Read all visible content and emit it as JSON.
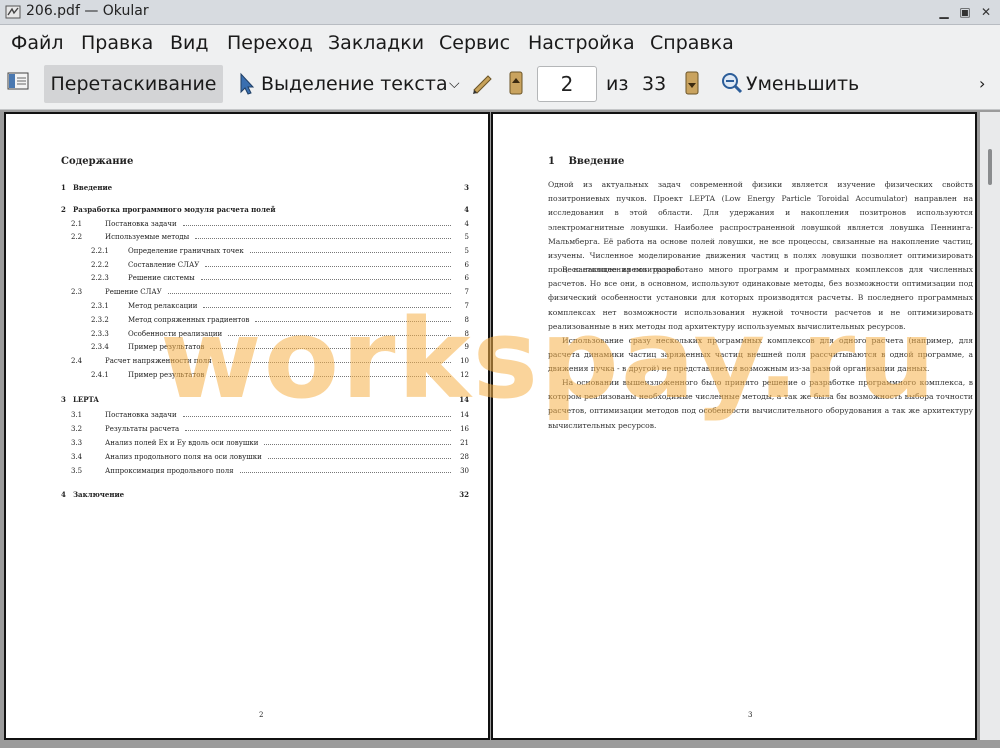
{
  "window": {
    "title": "206.pdf  — Okular"
  },
  "menu": [
    "Файл",
    "Правка",
    "Вид",
    "Переход",
    "Закладки",
    "Сервис",
    "Настройка",
    "Справка"
  ],
  "toolbar": {
    "browse": "Перетаскивание",
    "select": "Выделение текста",
    "page_value": "2",
    "of_label": "из",
    "total": "33",
    "zoom_out": "Уменьшить"
  },
  "page_left": {
    "heading": "Содержание",
    "number": "2",
    "toc": [
      {
        "num": "1",
        "title": "Введение",
        "page": "3",
        "level": 0,
        "bold": true
      },
      {
        "num": "2",
        "title": "Разработка программного модуля расчета полей",
        "page": "4",
        "level": 0,
        "bold": true
      },
      {
        "num": "2.1",
        "title": "Постановка задачи",
        "page": "4",
        "level": 1
      },
      {
        "num": "2.2",
        "title": "Используемые методы",
        "page": "5",
        "level": 1
      },
      {
        "num": "2.2.1",
        "title": "Определение граничных точек",
        "page": "5",
        "level": 2
      },
      {
        "num": "2.2.2",
        "title": "Составление СЛАУ",
        "page": "6",
        "level": 2
      },
      {
        "num": "2.2.3",
        "title": "Решение системы",
        "page": "6",
        "level": 2
      },
      {
        "num": "2.3",
        "title": "Решение СЛАУ",
        "page": "7",
        "level": 1
      },
      {
        "num": "2.3.1",
        "title": "Метод релаксации",
        "page": "7",
        "level": 2
      },
      {
        "num": "2.3.2",
        "title": "Метод сопряженных градиентов",
        "page": "8",
        "level": 2
      },
      {
        "num": "2.3.3",
        "title": "Особенности реализации",
        "page": "8",
        "level": 2
      },
      {
        "num": "2.3.4",
        "title": "Пример результатов",
        "page": "9",
        "level": 2
      },
      {
        "num": "2.4",
        "title": "Расчет напряженности поля",
        "page": "10",
        "level": 1
      },
      {
        "num": "2.4.1",
        "title": "Пример результатов",
        "page": "12",
        "level": 2
      },
      {
        "num": "3",
        "title": "LEPTA",
        "page": "14",
        "level": 0,
        "bold": true
      },
      {
        "num": "3.1",
        "title": "Постановка задачи",
        "page": "14",
        "level": 1
      },
      {
        "num": "3.2",
        "title": "Результаты расчета",
        "page": "16",
        "level": 1
      },
      {
        "num": "3.3",
        "title": "Анализ полей Ex и Ey вдоль оси ловушки",
        "page": "21",
        "level": 1
      },
      {
        "num": "3.4",
        "title": "Анализ продольного поля на оси ловушки",
        "page": "28",
        "level": 1
      },
      {
        "num": "3.5",
        "title": "Аппроксимация продольного поля",
        "page": "30",
        "level": 1
      },
      {
        "num": "4",
        "title": "Заключение",
        "page": "32",
        "level": 0,
        "bold": true
      }
    ]
  },
  "page_right": {
    "heading_num": "1",
    "heading": "Введение",
    "number": "3",
    "paragraphs": [
      "Одной из актуальных задач современной физики является изучение физических свойств позитрониевых пучков. Проект LEPTA (Low Energy Particle Toroidal Accumulator) направлен на исследования в этой области. Для удержания и накопления позитронов используются электромагнитные ловушки. Наиболее распространенной ловушкой является ловушка Пеннинга-Мальмберга. Её работа на основе полей ловушки, не все процессы, связанные на накопление частиц, изучены. Численное моделирование движения частиц в полях ловушки позволяет оптимизировать процесс накопления позитронов.",
      "В настоящее время разработано много программ и программных комплексов для численных расчетов. Но все они, в основном, используют одинаковые методы, без возможности оптимизации под физический особенности установки для которых производятся расчеты. В последнего программных комплексах нет возможности использования нужной точности расчетов и не оптимизировать реализованные в них методы под архитектуру используемых вычислительных ресурсов.",
      "Использование сразу нескольких программных комплексов для одного расчета (например, для расчета динамики частиц заряженных частиц внешней поля рассчитываются в одной программе, а движения пучка - в другой) не представляется возможным из-за разной организации данных.",
      "На основании вышеизложенного было принято решение о разработке программного комплекса, в котором реализованы необходимые численные методы, а так же была бы возможность выбора точности расчетов, оптимизации методов под особенности вычислительного оборудования а так же архитектуру вычислительных ресурсов."
    ]
  },
  "watermark": "workspay.ru",
  "colors": {
    "watermark": "#f6b048",
    "menubar": "#eff0f1",
    "titlebar": "#d7dbe0",
    "doc_bg": "#9b9b9b"
  }
}
